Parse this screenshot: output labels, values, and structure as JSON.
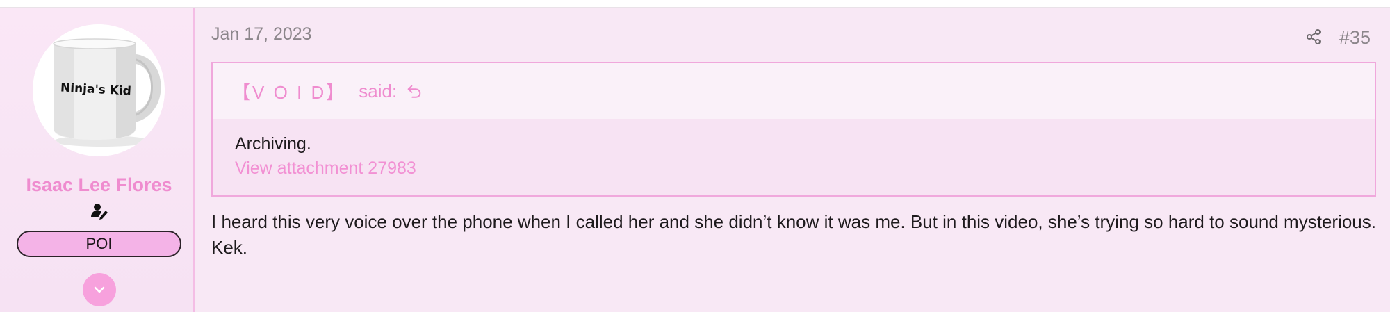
{
  "user": {
    "mug_text": "Ninja's Kid",
    "name": "Isaac Lee Flores",
    "badge": "POI"
  },
  "post": {
    "date": "Jan 17, 2023",
    "number": "#35",
    "quote": {
      "author": "【V O I D】",
      "said": "said:",
      "text": "Archiving.",
      "attachment_link": "View attachment 27983"
    },
    "message": "I heard this very voice over the phone when I called her and she didn’t know it was me. But in this video, she’s trying so hard to sound mysterious. Kek."
  },
  "colors": {
    "accent": "#ef8ccf",
    "badge_bg": "#f4b3e7",
    "post_bg": "#f8e8f5",
    "quote_border": "#f0a8dc"
  },
  "icons": [
    "user-edit-icon",
    "chevron-down-icon",
    "share-icon",
    "quote-jump-icon"
  ]
}
